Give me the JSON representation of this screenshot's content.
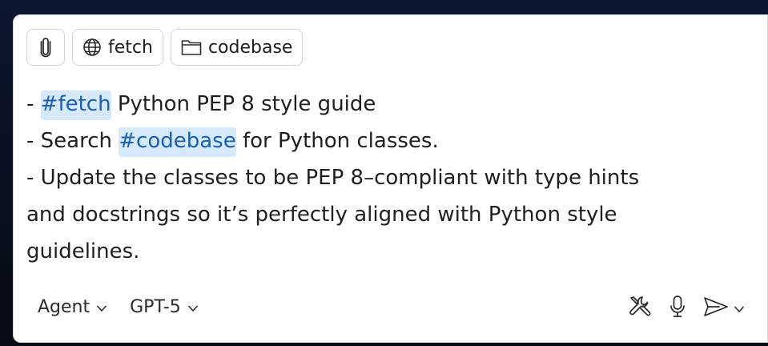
{
  "toolbar": {
    "attach_icon": "paperclip-icon",
    "chips": [
      {
        "icon": "globe-icon",
        "label": "fetch"
      },
      {
        "icon": "folder-icon",
        "label": "codebase"
      }
    ]
  },
  "message": {
    "line1": {
      "prefix": "- ",
      "tag": "#fetch",
      "suffix": " Python PEP 8 style guide"
    },
    "line2": {
      "prefix": "- Search ",
      "tag": "#codebase",
      "suffix": " for Python classes."
    },
    "line3": "- Update the classes to be PEP 8–compliant with type hints",
    "line4": "and docstrings so it’s perfectly aligned with Python style",
    "line5": "guidelines."
  },
  "footer": {
    "mode_label": "Agent",
    "model_label": "GPT-5",
    "icons": [
      "tools-icon",
      "microphone-icon",
      "send-icon",
      "chevron-down-icon"
    ]
  },
  "colors": {
    "tag_background": "#d6e9fb",
    "tag_text": "#1a5fb4",
    "panel_border": "#d6d6d6"
  }
}
